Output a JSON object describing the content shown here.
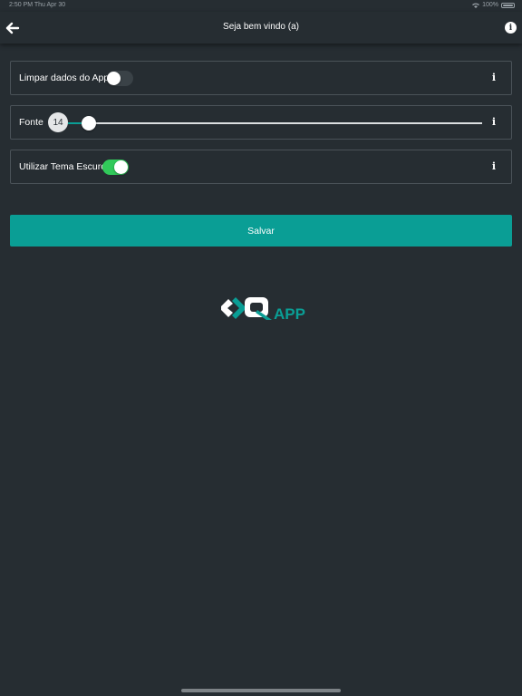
{
  "status_bar": {
    "time_date": "2:50 PM   Thu Apr 30",
    "battery": "100%"
  },
  "nav": {
    "title": "Seja bem vindo (a)",
    "info_glyph": "i"
  },
  "settings": {
    "clear_data": {
      "label": "Limpar dados do App",
      "enabled": false,
      "info_glyph": "i"
    },
    "font": {
      "label": "Fonte",
      "value": "14",
      "slider_fraction": 0.05,
      "info_glyph": "i"
    },
    "dark_theme": {
      "label": "Utilizar Tema Escuro",
      "enabled": true,
      "info_glyph": "i"
    }
  },
  "save_button": {
    "label": "Salvar"
  },
  "logo": {
    "text": "APP",
    "icon": "link-chain-icon"
  },
  "colors": {
    "background": "#262d32",
    "accent": "#0a9e95",
    "toggle_on": "#31c95a",
    "card_border": "#4a5258"
  }
}
